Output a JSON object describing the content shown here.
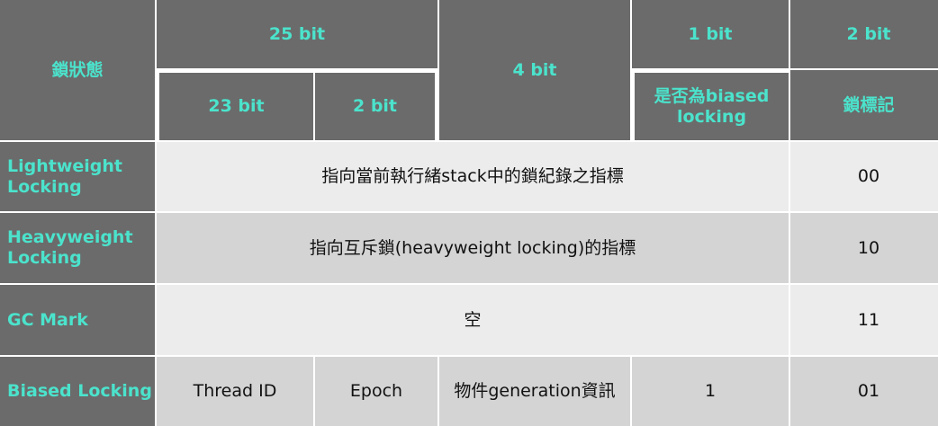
{
  "header": {
    "lock_state": "鎖狀態",
    "bits_25": "25 bit",
    "bits_4": "4 bit",
    "bits_1": "1 bit",
    "bits_2": "2 bit",
    "bits_23": "23 bit",
    "bits_2_sub": "2 bit",
    "is_biased": "是否為biased locking",
    "lock_flag": "鎖標記"
  },
  "rows": [
    {
      "state": "Lightweight Locking",
      "content": "指向當前執行緒stack中的鎖紀錄之指標",
      "flag": "00"
    },
    {
      "state": "Heavyweight Locking",
      "content": "指向互斥鎖(heavyweight locking)的指標",
      "flag": "10"
    },
    {
      "state": "GC Mark",
      "content": "空",
      "flag": "11"
    },
    {
      "state": "Biased Locking",
      "thread_id": "Thread ID",
      "epoch": "Epoch",
      "generation": "物件generation資訊",
      "biased": "1",
      "flag": "01"
    }
  ],
  "colors": {
    "header_bg": "#6b6b6b",
    "accent_text": "#4be3cc",
    "row_light": "#ececec",
    "row_dark": "#d4d4d4"
  }
}
